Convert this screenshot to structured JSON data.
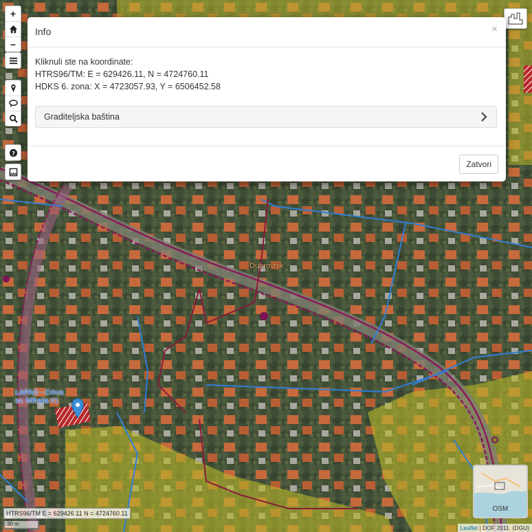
{
  "map": {
    "city_label": "Dubrovnik",
    "poi_label_line1": "LAPAD - Crkva",
    "poi_label_line2": "sv. Mihajla I/1",
    "coord_readout": "HTRS96/TM E = 629426.11 N = 4724760.11",
    "scale_label": "30 m",
    "minimap_label": "OSM",
    "attribution_link": "Leaflet",
    "attribution_text": " | DOF 2011. (DGU)"
  },
  "toolbar": {
    "zoom_in": "+",
    "zoom_out": "−",
    "icons": [
      "home-icon",
      "menu-icon",
      "marker-icon",
      "comment-icon",
      "search-icon",
      "help-icon",
      "measure-icon"
    ]
  },
  "modal": {
    "title": "Info",
    "close_glyph": "×",
    "intro": "Kliknuli ste na koordinate:",
    "htrs_line": "HTRS96/TM: E = 629426.11, N = 4724760.11",
    "hdks_line": "HDKS 6. zona: X = 4723057.93, Y = 6506452.58",
    "accordion_label": "Graditeljska baština",
    "close_button": "Zatvori"
  },
  "colors": {
    "aerial_dark": "#3d4a35",
    "roof": "#c96a3c",
    "road_outline": "#8a1a5a",
    "water_line": "#2f7fd6",
    "heritage_zone": "#b9b82a",
    "poi_marker": "#3a8fd8"
  }
}
